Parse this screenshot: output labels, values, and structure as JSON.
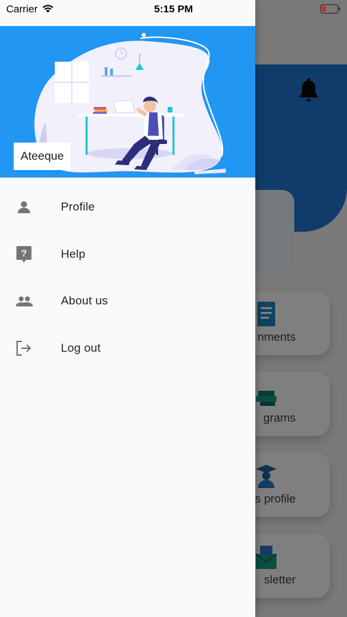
{
  "status_bar": {
    "carrier": "Carrier",
    "time": "5:15 PM"
  },
  "drawer": {
    "header": {
      "user_name": "Ateeque",
      "background_color": "#2196f3"
    },
    "items": [
      {
        "label": "Profile",
        "icon": "person-icon"
      },
      {
        "label": "Help",
        "icon": "help-icon"
      },
      {
        "label": "About us",
        "icon": "people-icon"
      },
      {
        "label": "Log out",
        "icon": "logout-icon"
      }
    ]
  },
  "background_app": {
    "header_color": "#1e78d6",
    "tiles": [
      {
        "label": "nments"
      },
      {
        "label": "grams"
      },
      {
        "label": "rs profile"
      },
      {
        "label": "sletter"
      }
    ]
  }
}
